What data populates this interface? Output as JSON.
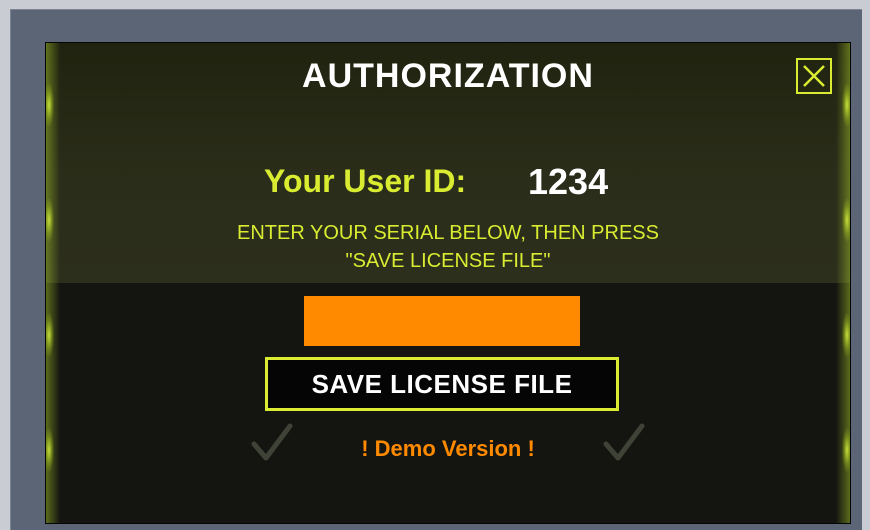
{
  "dialog": {
    "title": "AUTHORIZATION",
    "close_icon": "close-icon"
  },
  "user": {
    "label": "Your User ID:",
    "id": "1234"
  },
  "instructions": {
    "line1": "ENTER YOUR SERIAL BELOW, THEN PRESS",
    "line2": "\"SAVE LICENSE FILE\""
  },
  "serial": {
    "value": "",
    "placeholder": ""
  },
  "actions": {
    "save_label": "SAVE LICENSE FILE"
  },
  "status": {
    "demo_text": "! Demo Version  !",
    "check_icon": "checkmark-icon"
  },
  "colors": {
    "accent": "#d9ec31",
    "input_bg": "#ff8a00",
    "demo_text": "#ff8a00",
    "panel_bg": "#141510",
    "frame": "#5c6576"
  }
}
